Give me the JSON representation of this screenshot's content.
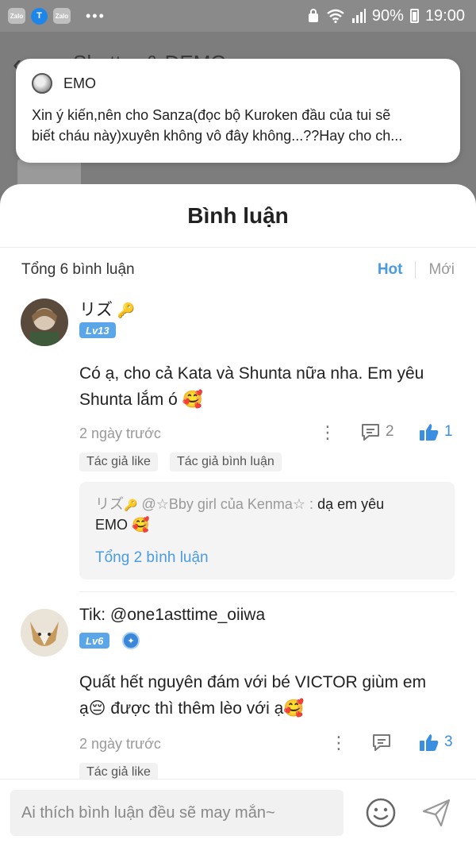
{
  "status_bar": {
    "left_icons": [
      "Zalo",
      "T",
      "Zalo"
    ],
    "battery": "90%",
    "time": "19:00"
  },
  "background": {
    "title": "Shutter & DEMO"
  },
  "notification": {
    "sender": "EMO",
    "line1": "Xin ý kiến,nên cho Sanza(đọc bộ Kuroken đầu của tui sẽ",
    "line2": "biết cháu này)xuyên không vô đây không...??Hay cho ch..."
  },
  "sheet": {
    "title": "Bình luận",
    "total": "Tổng 6 bình luận",
    "sort_hot": "Hot",
    "sort_new": "Mới"
  },
  "comments": [
    {
      "username": "リズ",
      "level": "Lv13",
      "line1": "Có ạ, cho cả Kata và Shunta nữa nha. Em yêu",
      "line2": "Shunta lắm ó 🥰",
      "time": "2 ngày trước",
      "reply_count": "2",
      "like_count": "1",
      "tags": [
        "Tác giả like",
        "Tác giả bình luận"
      ],
      "reply": {
        "author": "リズ",
        "mention": " @☆Bby girl của Kenma☆ : ",
        "text_a": "dạ em yêu",
        "text_b": "EMO 🥰",
        "total": "Tổng 2 bình luận"
      }
    },
    {
      "username": "Tik: @one1asttime_oiiwa",
      "level": "Lv6",
      "line1": "Quất hết nguyên đám với bé VICTOR giùm em",
      "line2": "ạ😔 được thì thêm lèo với ạ🥰",
      "time": "2 ngày trước",
      "like_count": "3",
      "tags": [
        "Tác giả like"
      ]
    }
  ],
  "input": {
    "placeholder": "Ai thích bình luận đều sẽ may mắn~"
  },
  "colors": {
    "accent": "#4a9be0",
    "like_blue": "#3a8fe0",
    "status_bar": "#8a8a8a"
  }
}
